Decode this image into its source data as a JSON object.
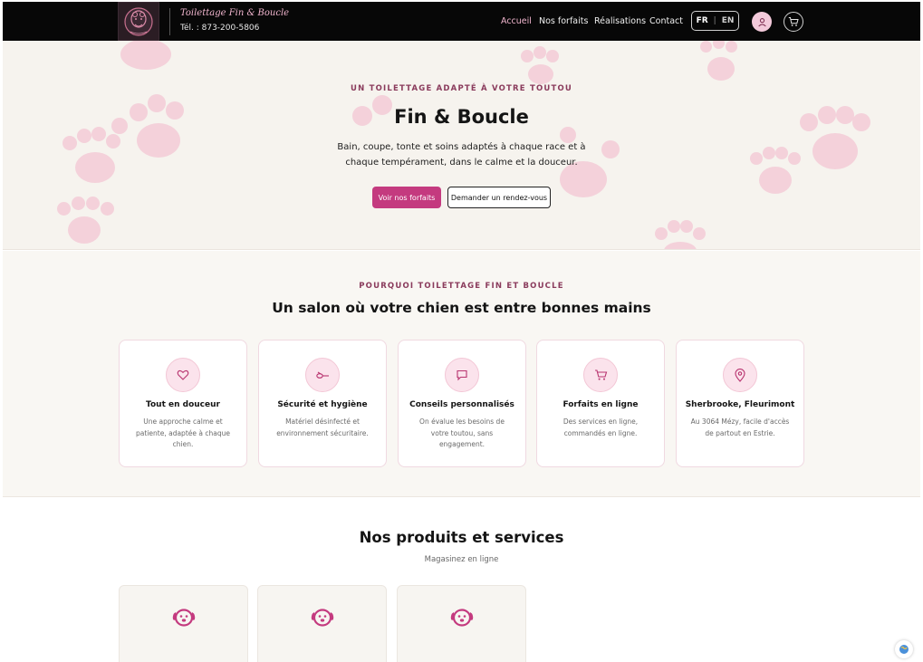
{
  "header": {
    "brand_name": "Toilettage Fin & Boucle",
    "phone": "Tél. : 873-200-5806",
    "nav": [
      {
        "label": "Accueil",
        "active": true
      },
      {
        "label": "Nos forfaits",
        "active": false
      },
      {
        "label": "Réalisations",
        "active": false
      },
      {
        "label": "Contact",
        "active": false
      }
    ],
    "lang_fr": "FR",
    "lang_sep": "|",
    "lang_en": "EN",
    "user_icon": "user-icon",
    "cart_icon": "cart-icon"
  },
  "hero": {
    "eyebrow": "UN TOILETTAGE ADAPTÉ À VOTRE TOUTOU",
    "title": "Fin & Boucle",
    "text": "Bain, coupe, tonte et soins adaptés à chaque race et à chaque tempérament, dans le calme et la douceur.",
    "primary_button": "Voir nos forfaits",
    "secondary_button": "Demander un rendez-vous"
  },
  "why": {
    "eyebrow": "POURQUOI TOILETTAGE FIN ET BOUCLE",
    "title": "Un salon où votre chien est entre bonnes mains",
    "cards": [
      {
        "icon": "heart-icon",
        "title": "Tout en douceur",
        "desc": "Une approche calme et patiente, adaptée à chaque chien."
      },
      {
        "icon": "scissors-icon",
        "title": "Sécurité et hygiène",
        "desc": "Matériel désinfecté et environnement sécuritaire."
      },
      {
        "icon": "chat-icon",
        "title": "Conseils personnalisés",
        "desc": "On évalue les besoins de votre toutou, sans engagement."
      },
      {
        "icon": "cart-icon",
        "title": "Forfaits en ligne",
        "desc": "Des services en ligne, commandés en ligne."
      },
      {
        "icon": "location-icon",
        "title": "Sherbrooke, Fleurimont",
        "desc": "Au 3064 Mézy, facile d'accès de partout en Estrie."
      }
    ]
  },
  "products": {
    "title": "Nos produits et services",
    "subtitle": "Magasinez en ligne",
    "items": [
      {
        "icon": "dog-face-icon"
      },
      {
        "icon": "dog-face-icon"
      },
      {
        "icon": "dog-face-icon"
      }
    ]
  },
  "colors": {
    "accent": "#c43a7f",
    "header_bg": "#070707",
    "hero_bg": "#f6f3ee",
    "paw": "#f3c6d3"
  }
}
